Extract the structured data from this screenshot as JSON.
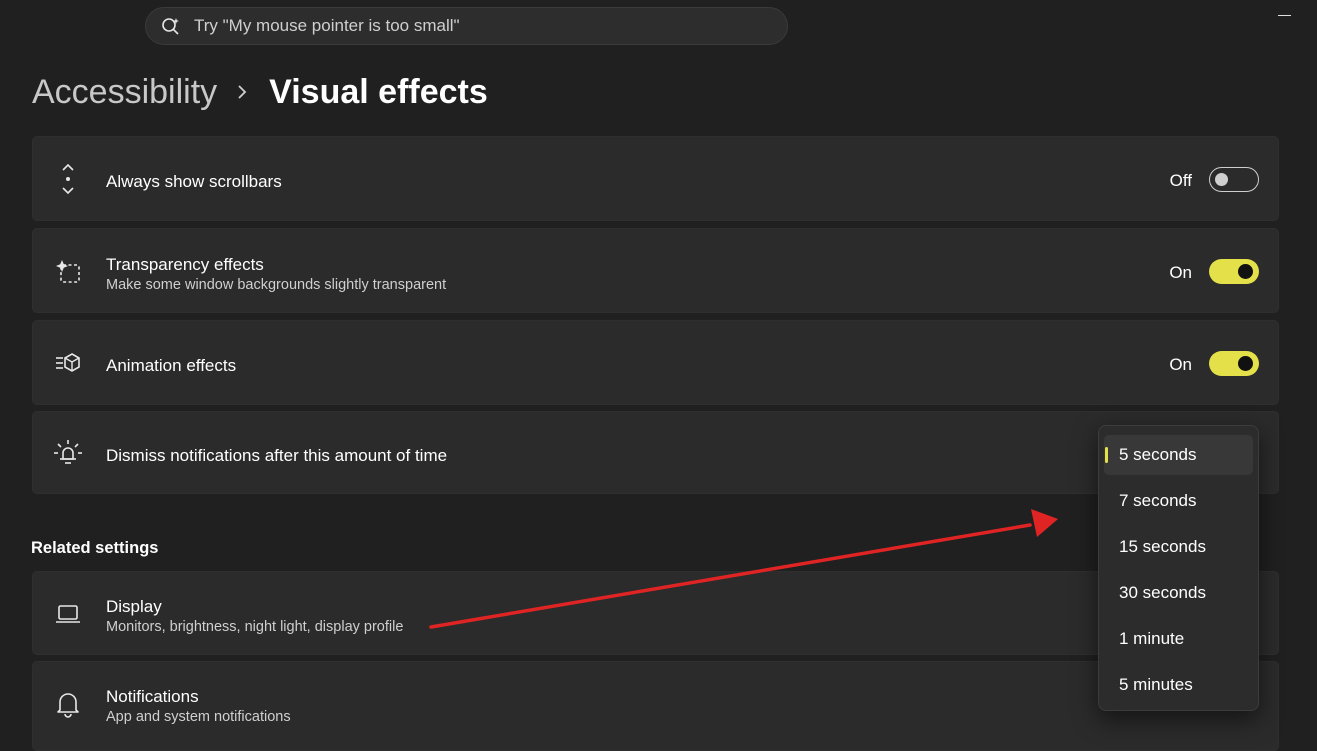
{
  "search": {
    "placeholder": "Try \"My mouse pointer is too small\"",
    "icon": "search-sparkle-icon"
  },
  "breadcrumb": {
    "parent": "Accessibility",
    "current": "Visual effects"
  },
  "settings": [
    {
      "title": "Always show scrollbars",
      "subtitle": "",
      "state": "Off",
      "toggle": false,
      "icon": "scrollbar-icon"
    },
    {
      "title": "Transparency effects",
      "subtitle": "Make some window backgrounds slightly transparent",
      "state": "On",
      "toggle": true,
      "icon": "transparency-icon"
    },
    {
      "title": "Animation effects",
      "subtitle": "",
      "state": "On",
      "toggle": true,
      "icon": "animation-icon"
    },
    {
      "title": "Dismiss notifications after this amount of time",
      "subtitle": "",
      "icon": "notification-timer-icon"
    }
  ],
  "related": {
    "heading": "Related settings",
    "items": [
      {
        "title": "Display",
        "subtitle": "Monitors, brightness, night light, display profile",
        "icon": "laptop-icon"
      },
      {
        "title": "Notifications",
        "subtitle": "App and system notifications",
        "icon": "bell-icon"
      }
    ]
  },
  "dropdown": {
    "selected": "5 seconds",
    "options": [
      "5 seconds",
      "7 seconds",
      "15 seconds",
      "30 seconds",
      "1 minute",
      "5 minutes"
    ]
  },
  "colors": {
    "accent": "#e3e04a",
    "background": "#202020",
    "card": "#2b2b2b",
    "annotation_arrow": "#e02424"
  }
}
